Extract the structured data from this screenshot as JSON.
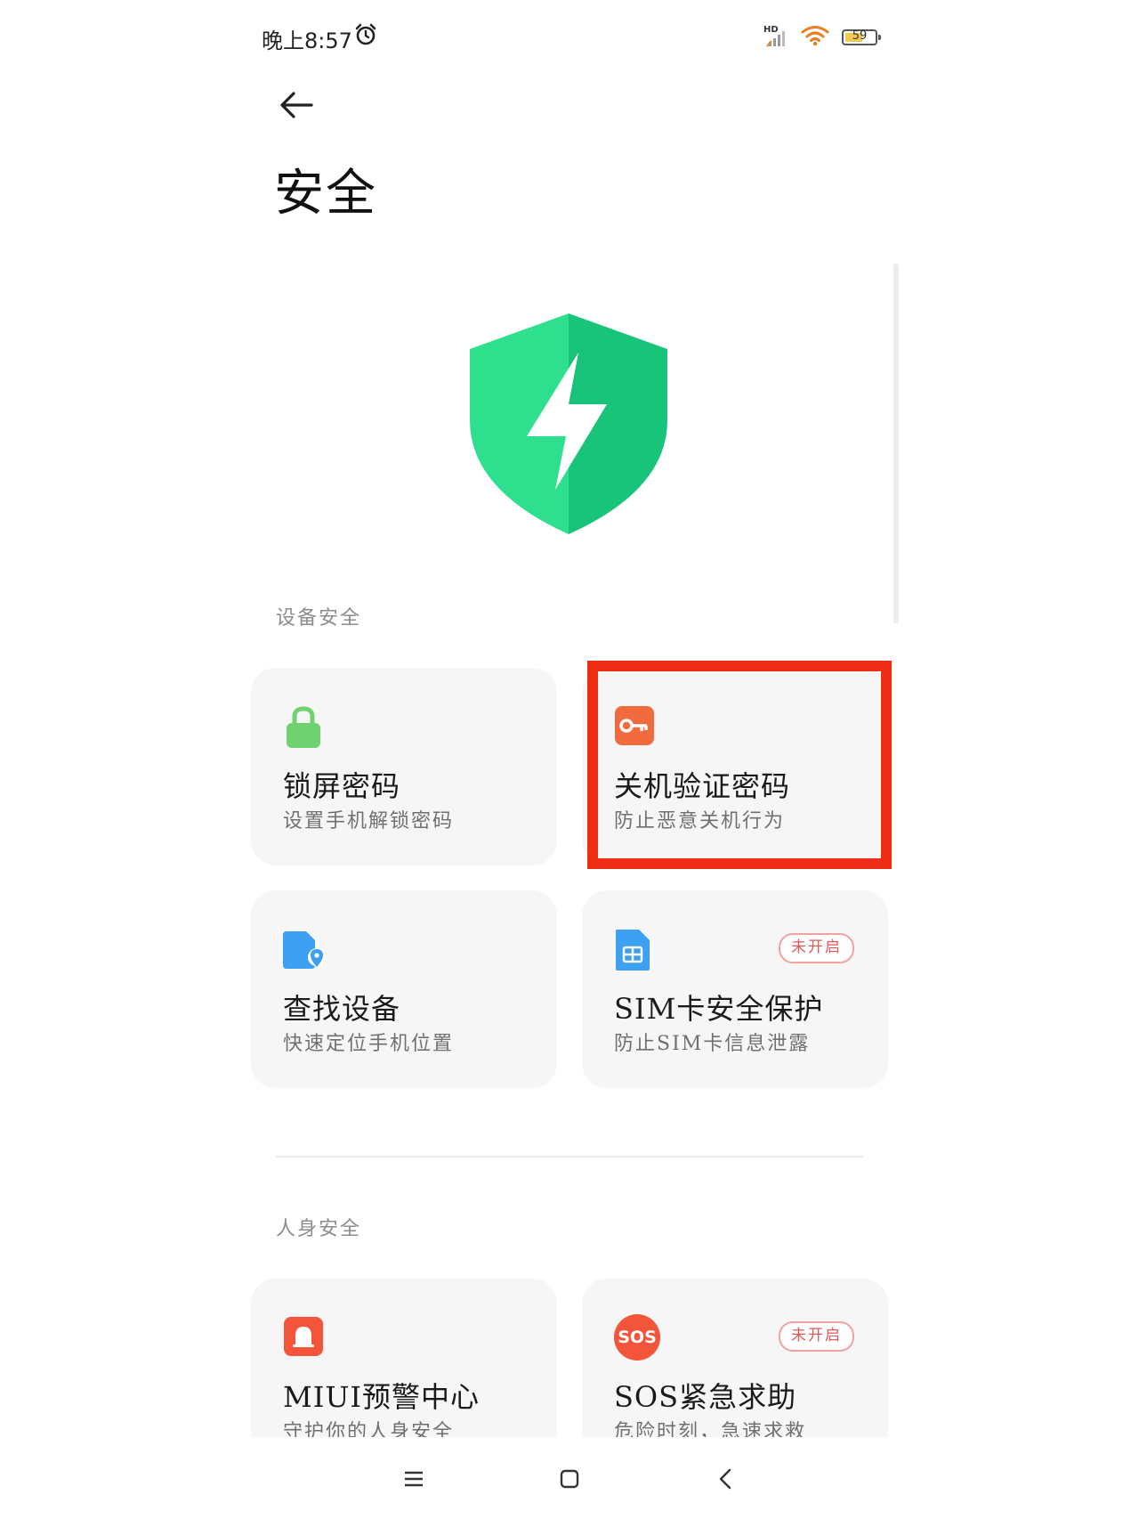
{
  "status_bar": {
    "time": "晚上8:57",
    "hd_label": "HD",
    "battery": "59",
    "battery_level": 0.59
  },
  "header": {
    "title": "安全"
  },
  "sections": {
    "device": {
      "label": "设备安全",
      "cards": [
        {
          "title": "锁屏密码",
          "subtitle": "设置手机解锁密码",
          "icon": "lock-icon",
          "color": "#6fd16f"
        },
        {
          "title": "关机验证密码",
          "subtitle": "防止恶意关机行为",
          "icon": "key-icon",
          "color": "#f26b3f",
          "highlighted": true
        },
        {
          "title": "查找设备",
          "subtitle": "快速定位手机位置",
          "icon": "locate-device-icon",
          "color": "#3ea0f2"
        },
        {
          "title": "SIM卡安全保护",
          "subtitle": "防止SIM卡信息泄露",
          "icon": "sim-card-icon",
          "color": "#3ea0f2",
          "badge": "未开启"
        }
      ]
    },
    "personal": {
      "label": "人身安全",
      "cards": [
        {
          "title": "MIUI预警中心",
          "subtitle": "守护你的人身安全",
          "icon": "alert-bell-icon",
          "color": "#f3553a"
        },
        {
          "title": "SOS紧急求助",
          "subtitle": "危险时刻，急速求救",
          "icon": "sos-icon",
          "icon_text": "SOS",
          "color": "#f3553a",
          "badge": "未开启"
        }
      ]
    }
  },
  "colors": {
    "shield_light": "#2ee08e",
    "shield_dark": "#17c47a",
    "highlight": "#ee2d16"
  }
}
